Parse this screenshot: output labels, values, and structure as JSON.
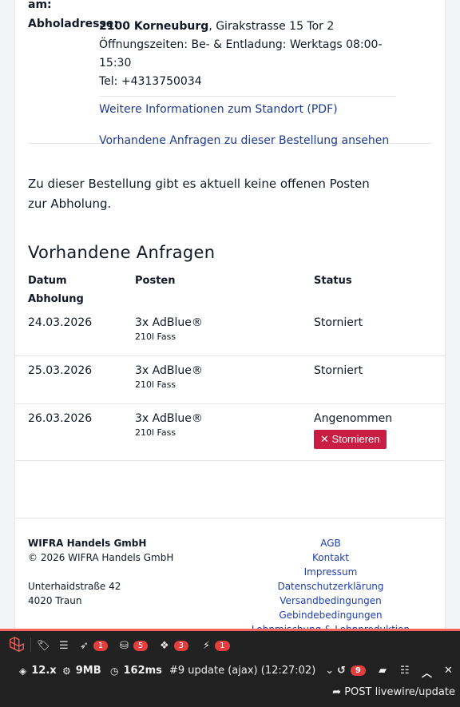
{
  "pickup": {
    "label_am": "am:",
    "label_address": "Abholadresse:",
    "address_bold": "2100 Korneuburg",
    "address_rest": ", Girakstrasse 15 Tor 2",
    "hours": "Öffnungszeiten: Be- & Entladung: Werktags 08:00-15:30",
    "phone": "Tel: +4313750034",
    "link_info": "Weitere Informationen zum Standort (PDF)",
    "link_requests": "Vorhandene Anfragen zu dieser Bestellung ansehen"
  },
  "notice": "Zu dieser Bestellung gibt es aktuell keine offenen Posten zur Abholung.",
  "requests": {
    "heading": "Vorhandene Anfragen",
    "columns": [
      "Datum Abholung",
      "Posten",
      "Status"
    ],
    "rows": [
      {
        "date": "24.03.2026",
        "item": "3x AdBlue®",
        "sub": "210l Fass",
        "status": "Storniert"
      },
      {
        "date": "25.03.2026",
        "item": "3x AdBlue®",
        "sub": "210l Fass",
        "status": "Storniert"
      },
      {
        "date": "26.03.2026",
        "item": "3x AdBlue®",
        "sub": "210l Fass",
        "status": "Angenommen"
      }
    ],
    "cancel_label": "Stornieren"
  },
  "footer": {
    "company": "WIFRA Handels GmbH",
    "copyright": "© 2026 WIFRA Handels GmbH",
    "street": "Unterhaidstraße 42",
    "city": "4020 Traun",
    "links": [
      "AGB",
      "Kontakt",
      "Impressum",
      "Datenschutzerklärung",
      "Versandbedingungen",
      "Gebindebedingungen",
      "Lohnmischung & Lohnproduktion"
    ]
  },
  "debugbar": {
    "badges": {
      "routes": "1",
      "queries": "5",
      "models": "3",
      "livewire": "1"
    },
    "version": "12.x",
    "memory": "9MB",
    "time": "162ms",
    "request_select": "#9 update (ajax) (12:27:02)",
    "history_count": "9",
    "request": "POST livewire/update"
  },
  "colors": {
    "link": "#1e3a8a",
    "danger": "#c81e44",
    "debug_accent": "#f4645f"
  }
}
